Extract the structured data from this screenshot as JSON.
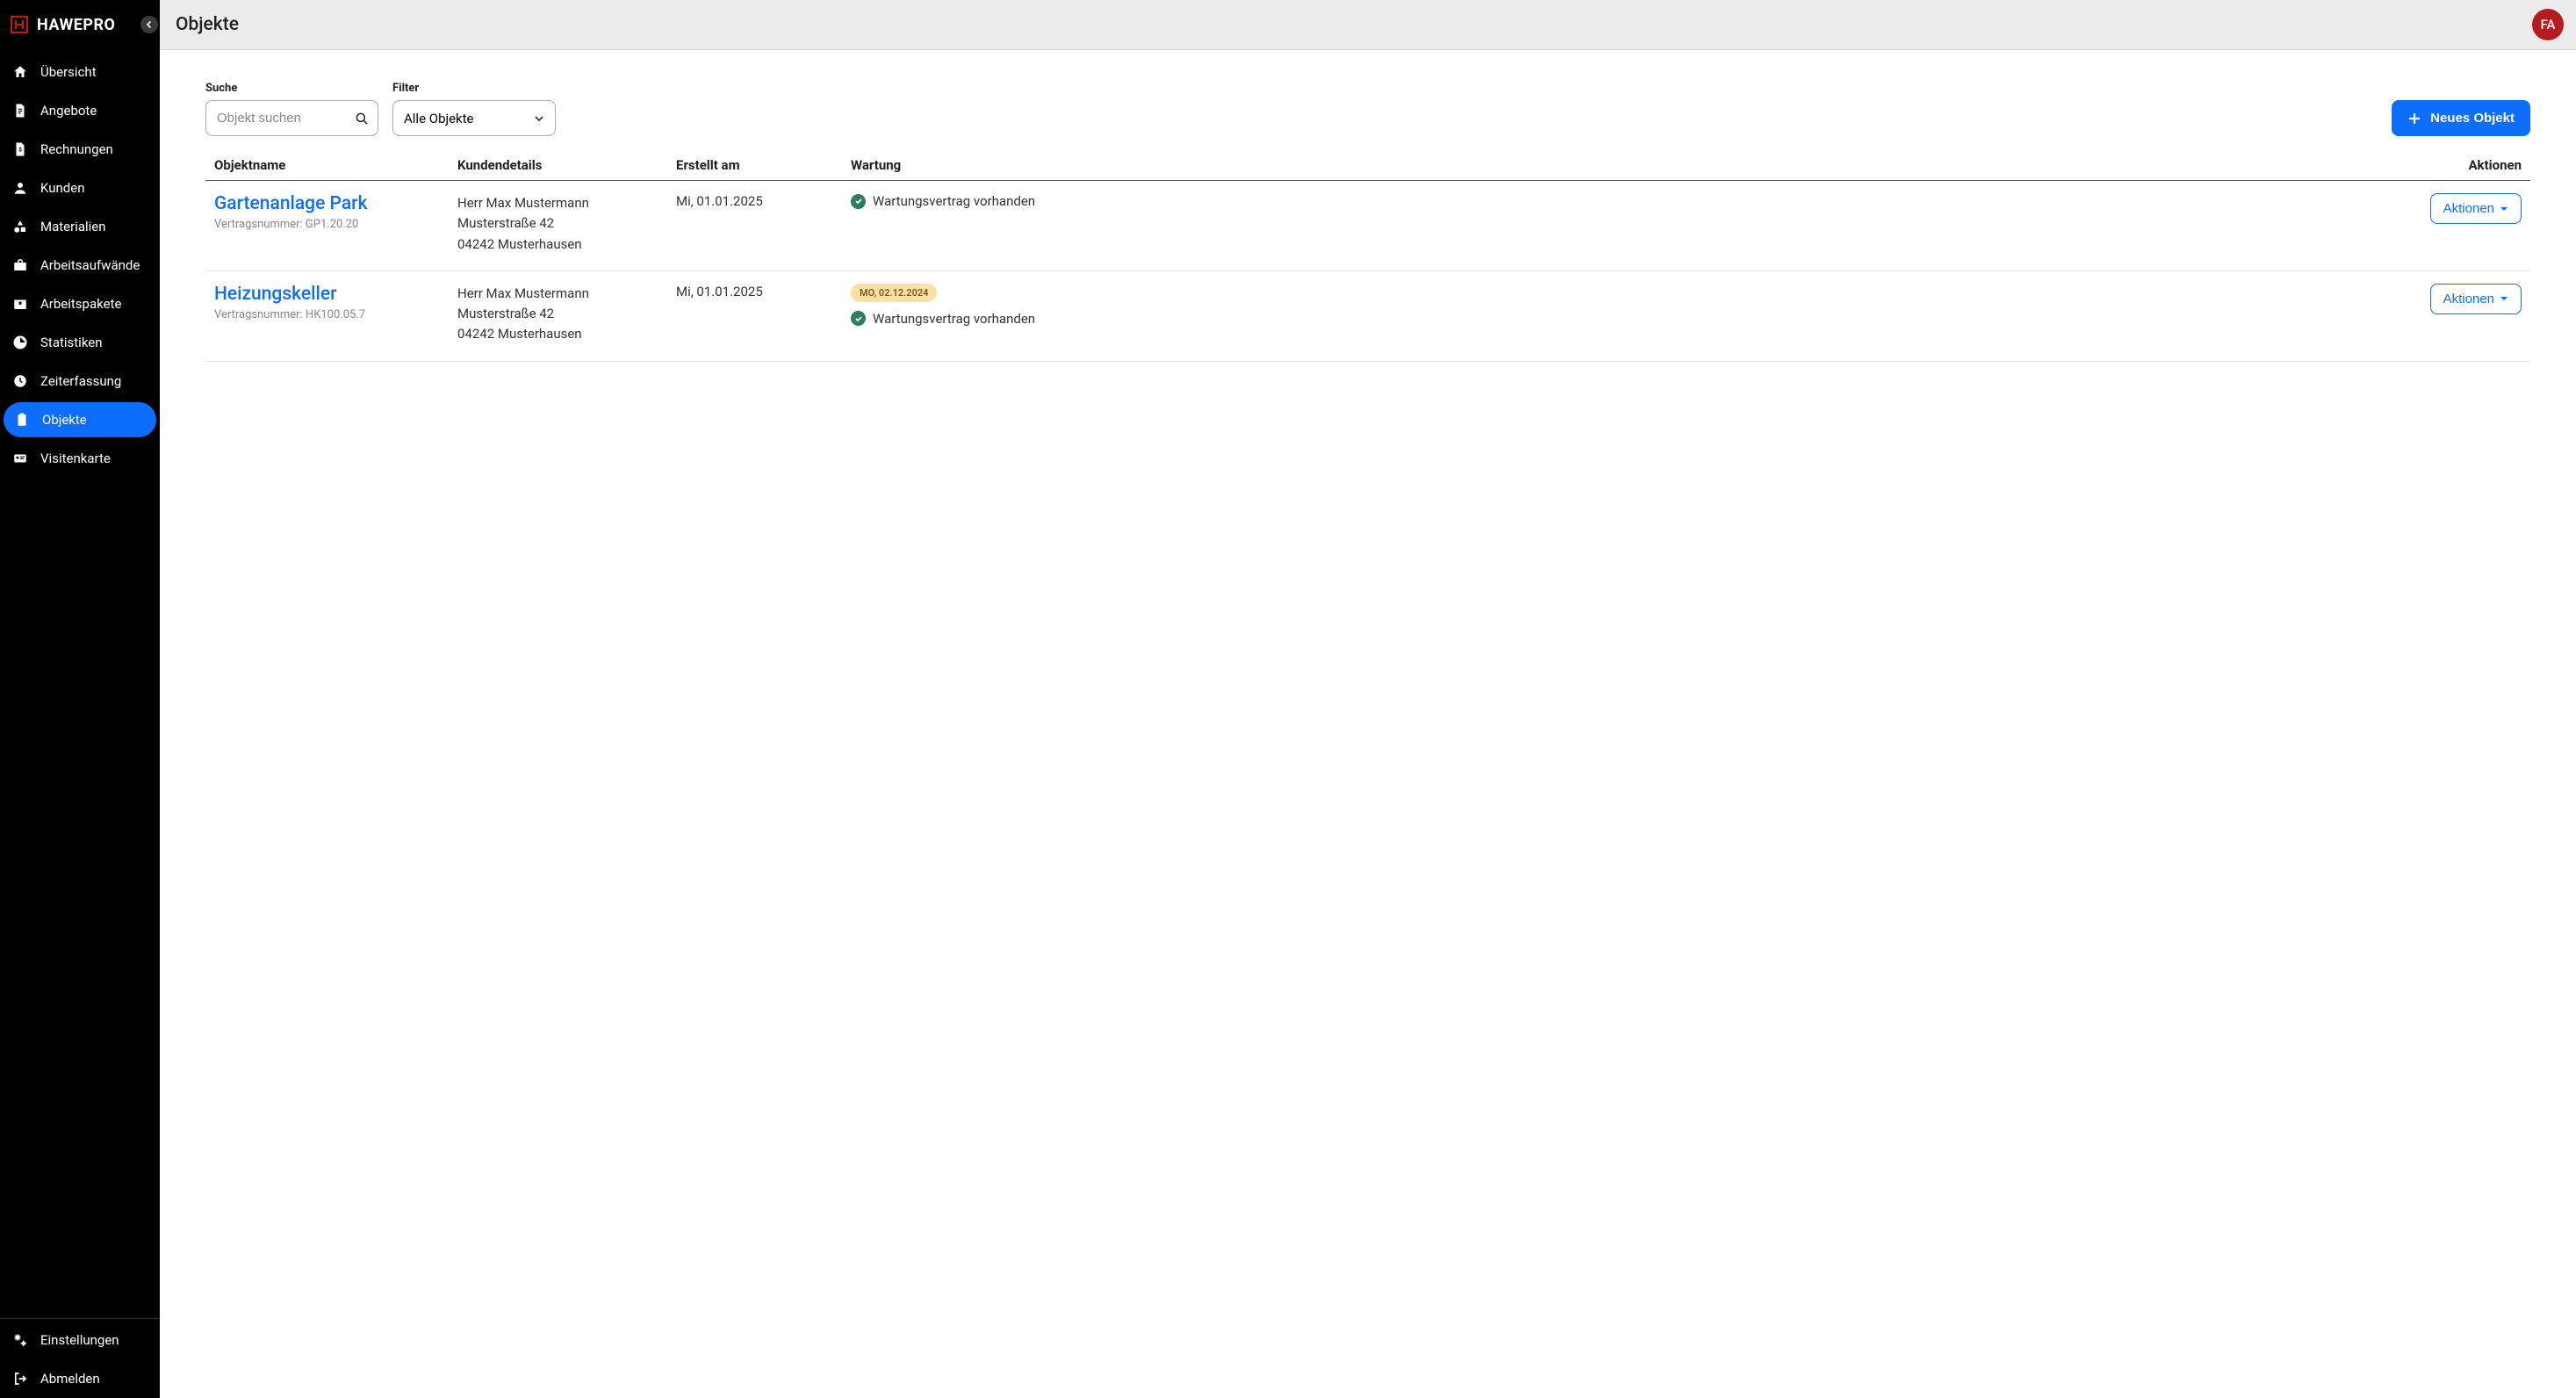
{
  "app": {
    "name": "HAWEPRO",
    "avatar_initials": "FA"
  },
  "sidebar": {
    "items": [
      {
        "label": "Übersicht",
        "icon": "home-icon"
      },
      {
        "label": "Angebote",
        "icon": "document-icon"
      },
      {
        "label": "Rechnungen",
        "icon": "invoice-icon"
      },
      {
        "label": "Kunden",
        "icon": "person-icon"
      },
      {
        "label": "Materialien",
        "icon": "shapes-icon"
      },
      {
        "label": "Arbeitsaufwände",
        "icon": "briefcase-icon"
      },
      {
        "label": "Arbeitspakete",
        "icon": "package-icon"
      },
      {
        "label": "Statistiken",
        "icon": "pie-chart-icon"
      },
      {
        "label": "Zeiterfassung",
        "icon": "clock-icon"
      },
      {
        "label": "Objekte",
        "icon": "clipboard-icon",
        "active": true
      },
      {
        "label": "Visitenkarte",
        "icon": "card-icon"
      }
    ],
    "footer": [
      {
        "label": "Einstellungen",
        "icon": "settings-icon"
      },
      {
        "label": "Abmelden",
        "icon": "logout-icon"
      }
    ]
  },
  "page": {
    "title": "Objekte"
  },
  "controls": {
    "search_label": "Suche",
    "search_placeholder": "Objekt suchen",
    "filter_label": "Filter",
    "filter_value": "Alle Objekte",
    "new_button_label": "Neues Objekt"
  },
  "table": {
    "columns": {
      "name": "Objektname",
      "customer": "Kundendetails",
      "created": "Erstellt am",
      "maintenance": "Wartung",
      "actions": "Aktionen"
    },
    "action_button_label": "Aktionen",
    "rows": [
      {
        "name": "Gartenanlage Park",
        "contract_label": "Vertragsnummer: GP1.20.20",
        "customer_name": "Herr Max Mustermann",
        "customer_street": "Musterstraße 42",
        "customer_city": "04242 Musterhausen",
        "created": "Mi, 01.01.2025",
        "date_badge": null,
        "maintenance_text": "Wartungsvertrag vorhanden"
      },
      {
        "name": "Heizungskeller",
        "contract_label": "Vertragsnummer: HK100.05.7",
        "customer_name": "Herr Max Mustermann",
        "customer_street": "Musterstraße 42",
        "customer_city": "04242 Musterhausen",
        "created": "Mi, 01.01.2025",
        "date_badge": "MO, 02.12.2024",
        "maintenance_text": "Wartungsvertrag vorhanden"
      }
    ]
  }
}
